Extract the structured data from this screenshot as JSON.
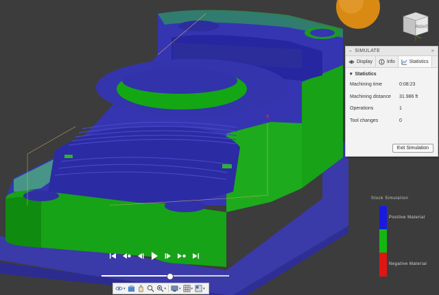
{
  "view_cube": {
    "face_label": "RIGHT"
  },
  "panel": {
    "title": "SIMULATE",
    "tabs": [
      {
        "label": "Display",
        "icon": "eye-icon"
      },
      {
        "label": "Info",
        "icon": "info-icon"
      },
      {
        "label": "Statistics",
        "icon": "chart-icon"
      }
    ],
    "active_tab": "Statistics",
    "section_title": "Statistics",
    "stats": [
      {
        "label": "Machining time",
        "value": "0:08:23"
      },
      {
        "label": "Machining distance",
        "value": "31.986 ft"
      },
      {
        "label": "Operations",
        "value": "1"
      },
      {
        "label": "Tool changes",
        "value": "0"
      }
    ],
    "exit_button": "Exit Simulation"
  },
  "legend": {
    "title": "Stock Simulation",
    "positive_label": "Positive Material",
    "negative_label": "Negative Material",
    "colors": {
      "positive": "#1a1adf",
      "neutral": "#12b812",
      "negative": "#e01515"
    }
  },
  "playback": {
    "buttons": [
      "skip-start-icon",
      "step-back-keyframe-icon",
      "step-back-icon",
      "play-icon",
      "step-forward-icon",
      "step-forward-keyframe-icon",
      "skip-end-icon"
    ],
    "progress": 0.53
  },
  "navbar": {
    "buttons": [
      "orbit-icon",
      "look-at-icon",
      "pan-icon",
      "zoom-icon",
      "fit-icon",
      "display-settings-icon",
      "grid-icon",
      "viewports-icon"
    ]
  },
  "colors": {
    "background": "#3c3c3c",
    "stock_blue": "#3a3ab0",
    "stock_green": "#1fa81f",
    "tool_orange": "#d88a12"
  }
}
